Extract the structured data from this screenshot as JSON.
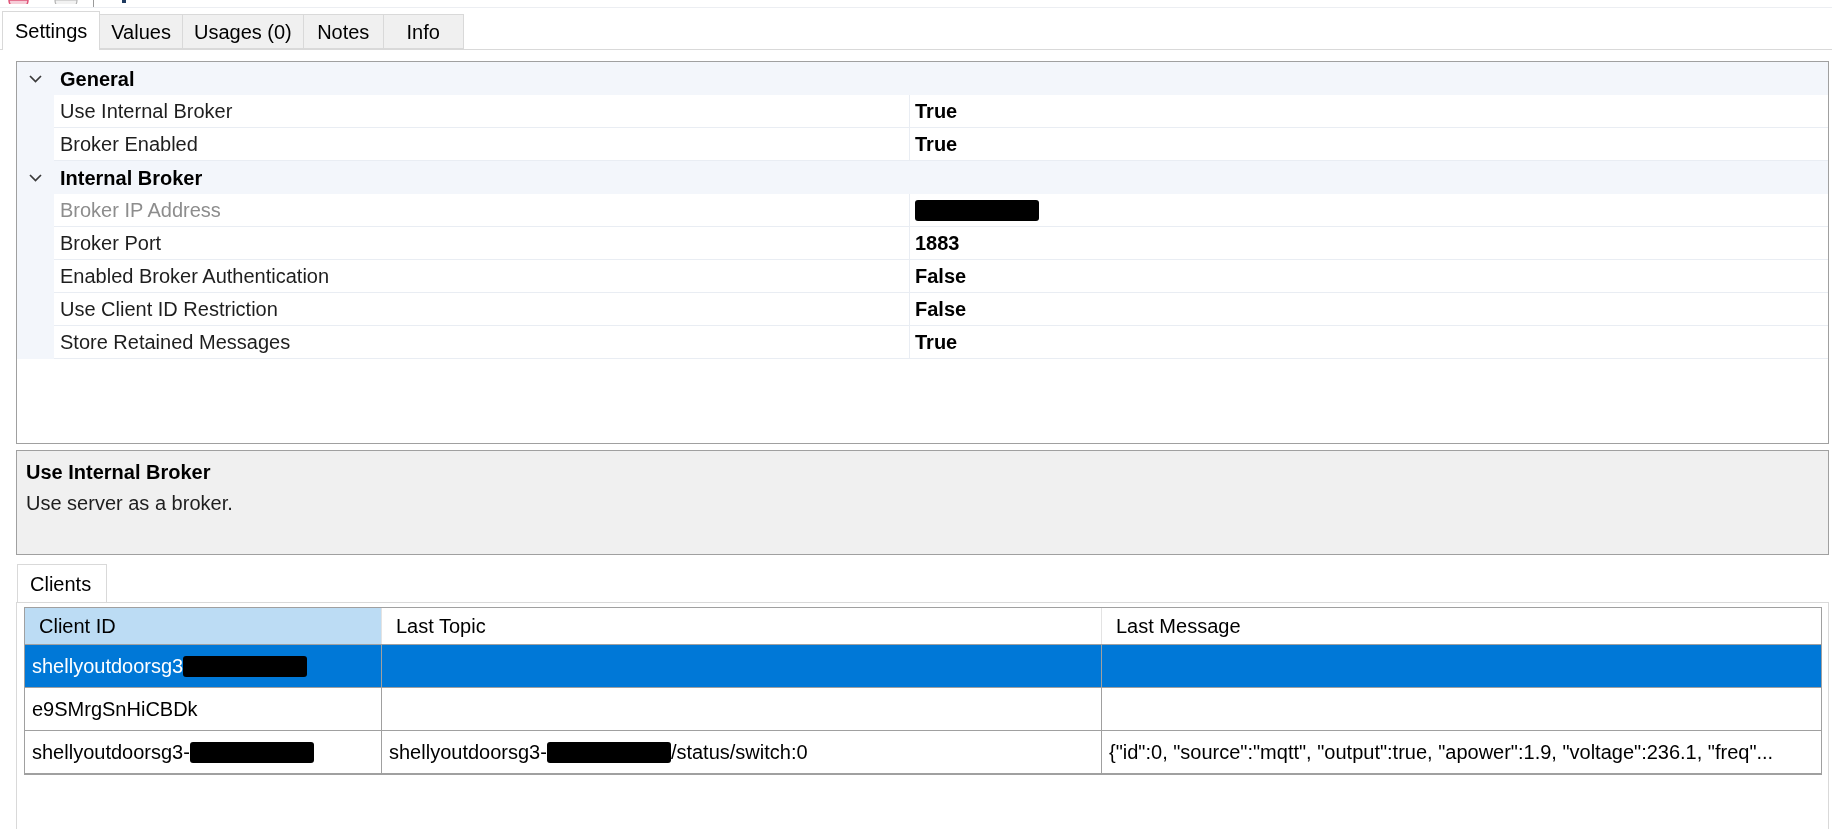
{
  "tabs": [
    {
      "label": "Settings",
      "selected": true
    },
    {
      "label": "Values",
      "selected": false
    },
    {
      "label": "Usages (0)",
      "selected": false
    },
    {
      "label": "Notes",
      "selected": false
    },
    {
      "label": "Info",
      "selected": false
    }
  ],
  "property_grid": {
    "categories": [
      {
        "name": "General",
        "expanded": true,
        "properties": [
          {
            "name": "Use Internal Broker",
            "disabled": false,
            "value": [
              {
                "kind": "text",
                "text": "True"
              }
            ]
          },
          {
            "name": "Broker Enabled",
            "disabled": false,
            "value": [
              {
                "kind": "text",
                "text": "True"
              }
            ]
          }
        ]
      },
      {
        "name": "Internal Broker",
        "expanded": true,
        "properties": [
          {
            "name": "Broker IP Address",
            "disabled": true,
            "value": [
              {
                "kind": "redacted"
              }
            ]
          },
          {
            "name": "Broker Port",
            "disabled": false,
            "value": [
              {
                "kind": "text",
                "text": "1883"
              }
            ]
          },
          {
            "name": "Enabled Broker Authentication",
            "disabled": false,
            "value": [
              {
                "kind": "text",
                "text": "False"
              }
            ]
          },
          {
            "name": "Use Client ID Restriction",
            "disabled": false,
            "value": [
              {
                "kind": "text",
                "text": "False"
              }
            ]
          },
          {
            "name": "Store Retained Messages",
            "disabled": false,
            "value": [
              {
                "kind": "text",
                "text": "True"
              }
            ]
          }
        ]
      }
    ]
  },
  "description": {
    "title": "Use Internal Broker",
    "text": "Use server as a broker."
  },
  "bottom_tabs": [
    {
      "label": "Clients",
      "selected": true
    }
  ],
  "clients_table": {
    "columns": [
      {
        "label": "Client ID",
        "selected": true
      },
      {
        "label": "Last Topic",
        "selected": false
      },
      {
        "label": "Last Message",
        "selected": false
      }
    ],
    "rows": [
      {
        "selected": true,
        "client_id": [
          {
            "kind": "text",
            "text": "shellyoutdoorsg3"
          },
          {
            "kind": "redacted"
          }
        ]
      },
      {
        "selected": false,
        "client_id": [
          {
            "kind": "text",
            "text": "e9SMrgSnHiCBDk"
          }
        ]
      },
      {
        "selected": false,
        "client_id": [
          {
            "kind": "text",
            "text": "shellyoutdoorsg3-"
          },
          {
            "kind": "redacted"
          }
        ],
        "last_topic": [
          {
            "kind": "text",
            "text": "shellyoutdoorsg3-"
          },
          {
            "kind": "redacted"
          },
          {
            "kind": "text",
            "text": "/status/switch:0"
          }
        ],
        "last_message": [
          {
            "kind": "text",
            "text": "{\"id\":0, \"source\":\"mqtt\", \"output\":true, \"apower\":1.9, \"voltage\":236.1, \"freq\"..."
          }
        ]
      }
    ]
  }
}
